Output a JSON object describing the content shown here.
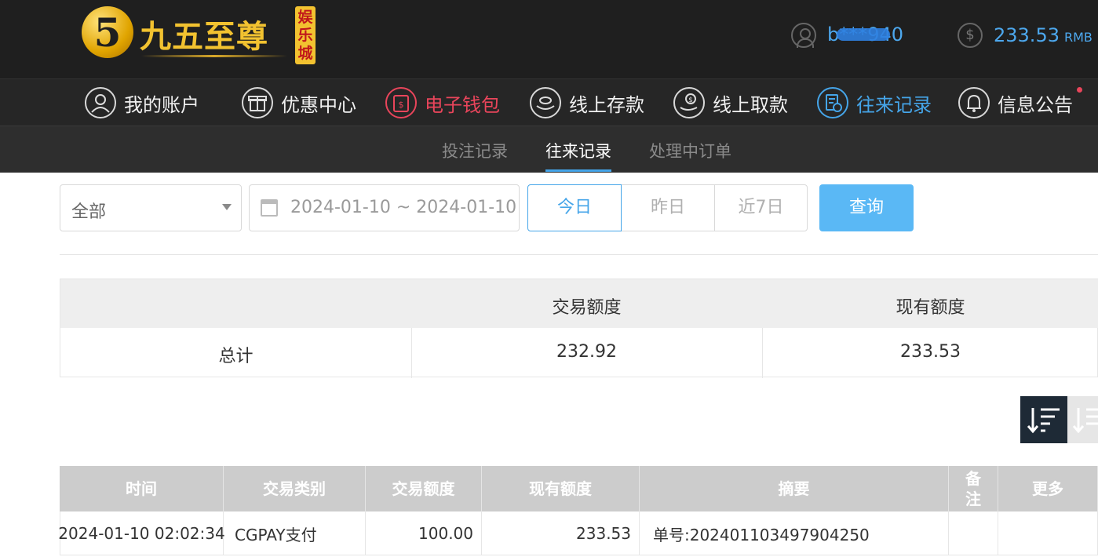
{
  "header": {
    "logo_badge": "娱乐城",
    "logo_text": "九五至尊",
    "logo_digit": "5",
    "username": "b***940",
    "balance": "233.53",
    "currency": "RMB"
  },
  "main_nav": [
    {
      "label": "我的账户",
      "icon": "user-icon"
    },
    {
      "label": "优惠中心",
      "icon": "gift-icon"
    },
    {
      "label": "电子钱包",
      "icon": "wallet-icon",
      "state": "active-red"
    },
    {
      "label": "线上存款",
      "icon": "deposit-icon"
    },
    {
      "label": "线上取款",
      "icon": "withdraw-icon"
    },
    {
      "label": "往来记录",
      "icon": "records-icon",
      "state": "active-blue"
    },
    {
      "label": "信息公告",
      "icon": "bell-icon"
    }
  ],
  "sub_nav": [
    "投注记录",
    "往来记录",
    "处理中订单"
  ],
  "filters": {
    "type_select": "全部",
    "date_range": "2024-01-10 ~ 2024-01-10",
    "quick_dates": [
      "今日",
      "昨日",
      "近7日"
    ],
    "query_label": "查询"
  },
  "summary": {
    "headers": [
      "交易额度",
      "现有额度"
    ],
    "row_label": "总计",
    "trade_amount": "232.92",
    "current_amount": "233.53"
  },
  "table": {
    "headers": [
      "时间",
      "交易类别",
      "交易额度",
      "现有额度",
      "摘要",
      "备注",
      "更多"
    ],
    "rows": [
      {
        "time": "2024-01-10 02:02:34",
        "type": "CGPAY支付",
        "amount": "100.00",
        "balance": "233.53",
        "summary": "单号:202401103497904250",
        "remark": "",
        "more": ""
      }
    ]
  },
  "colors": {
    "accent_blue": "#45a5e9",
    "accent_red": "#e9455b",
    "header_bg": "#1f1f1f",
    "gold": "#f2c230"
  }
}
